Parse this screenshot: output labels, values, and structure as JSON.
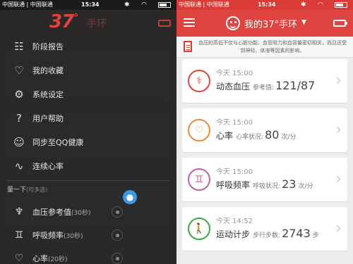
{
  "status_bar": {
    "carrier": "中国联通 | 中国联通",
    "time": "15:34"
  },
  "left": {
    "logo": "37",
    "logo_sup": "°",
    "band_label": "手环",
    "menu": [
      {
        "icon": "calendar-icon",
        "glyph": "☷",
        "label": "阶段报告"
      },
      {
        "icon": "heart-icon",
        "glyph": "♡",
        "label": "我的收藏"
      },
      {
        "icon": "gear-icon",
        "glyph": "⚙",
        "label": "系统设定"
      },
      {
        "icon": "question-icon",
        "glyph": "?",
        "label": "用户帮助"
      },
      {
        "icon": "qq-icon",
        "glyph": "☺",
        "label": "同步至QQ健康"
      },
      {
        "icon": "pulse-icon",
        "glyph": "∿",
        "label": "连续心率"
      }
    ],
    "section": {
      "title": "量一下",
      "subtitle": "(可多选)"
    },
    "quick_items": [
      {
        "icon": "stethoscope-icon",
        "glyph": "♆",
        "label": "血压参考值",
        "suffix": "(30秒)"
      },
      {
        "icon": "lungs-icon",
        "glyph": "♊",
        "label": "呼吸频率",
        "suffix": "(30秒)"
      },
      {
        "icon": "heart-outline-icon",
        "glyph": "♡",
        "label": "心率",
        "suffix": "(20秒)"
      }
    ]
  },
  "right": {
    "title": "我的37°手环",
    "tip": "血压的高低不仅与心脏功能、血管阻力和血容量密切相关，而且还受到神经、体液等因素的影响。",
    "cards": [
      {
        "icon": "stethoscope-icon",
        "glyph": "⚕",
        "color": "#e04440",
        "time": "今天 15:00",
        "name": "动态血压",
        "ref_label": "参考值:",
        "value": "121/87",
        "unit": ""
      },
      {
        "icon": "heart-icon",
        "glyph": "♡",
        "color": "#f08a3a",
        "time": "今天 15:00",
        "name": "心率",
        "ref_label": "心率状况:",
        "value": "80",
        "unit": "次/分"
      },
      {
        "icon": "lungs-icon",
        "glyph": "♊",
        "color": "#c05fa0",
        "time": "今天 15:00",
        "name": "呼吸频率",
        "ref_label": "呼吸状况:",
        "value": "23",
        "unit": "次/分"
      },
      {
        "icon": "walker-icon",
        "glyph": "🚶",
        "color": "#3aa84a",
        "time": "今天 14:52",
        "name": "运动计步",
        "ref_label": "步行步数:",
        "value": "2743",
        "unit": "步"
      }
    ]
  }
}
